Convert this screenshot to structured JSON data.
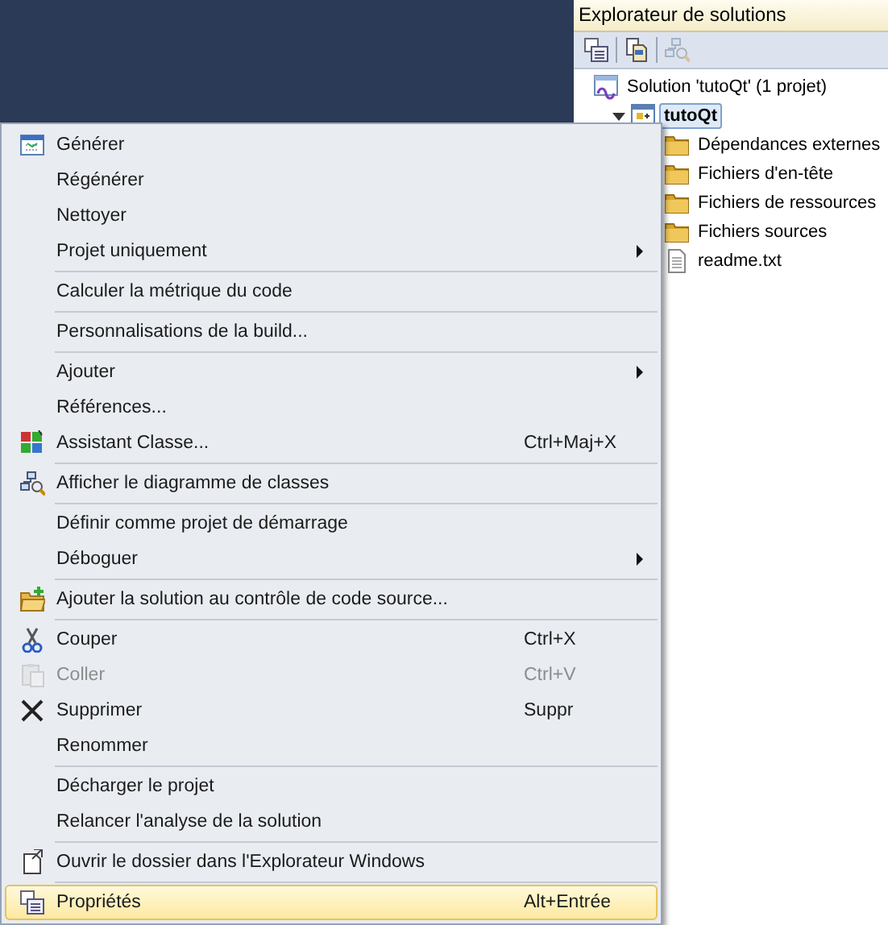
{
  "solution_explorer": {
    "title": "Explorateur de solutions",
    "toolbar": [
      {
        "disabled": false
      },
      {
        "disabled": false
      },
      {
        "disabled": true
      }
    ],
    "tree": [
      {
        "label": "Solution 'tutoQt' (1 projet)",
        "kind": "solution",
        "selected": false,
        "children": [
          {
            "label": "tutoQt",
            "kind": "project",
            "selected": true,
            "expanded": true,
            "children": [
              {
                "label": "Dépendances externes",
                "kind": "folder",
                "selected": false
              },
              {
                "label": "Fichiers d'en-tête",
                "kind": "folder",
                "selected": false
              },
              {
                "label": "Fichiers de ressources",
                "kind": "folder",
                "selected": false
              },
              {
                "label": "Fichiers sources",
                "kind": "folder",
                "selected": false
              },
              {
                "label": "readme.txt",
                "kind": "file",
                "selected": false
              }
            ]
          }
        ]
      }
    ]
  },
  "context_menu": [
    {
      "kind": "item",
      "label": "Générer",
      "selected": false,
      "disabled": false
    },
    {
      "kind": "item",
      "label": "Régénérer",
      "selected": false,
      "disabled": false
    },
    {
      "kind": "item",
      "label": "Nettoyer",
      "selected": false,
      "disabled": false
    },
    {
      "kind": "item",
      "label": "Projet uniquement",
      "submenu": true,
      "selected": false,
      "disabled": false
    },
    {
      "kind": "separator"
    },
    {
      "kind": "item",
      "label": "Calculer la métrique du code",
      "selected": false,
      "disabled": false
    },
    {
      "kind": "separator"
    },
    {
      "kind": "item",
      "label": "Personnalisations de la build...",
      "selected": false,
      "disabled": false
    },
    {
      "kind": "separator"
    },
    {
      "kind": "item",
      "label": "Ajouter",
      "submenu": true,
      "selected": false,
      "disabled": false
    },
    {
      "kind": "item",
      "label": "Références...",
      "selected": false,
      "disabled": false
    },
    {
      "kind": "item",
      "label": "Assistant Classe...",
      "shortcut": "Ctrl+Maj+X",
      "selected": false,
      "disabled": false
    },
    {
      "kind": "separator"
    },
    {
      "kind": "item",
      "label": "Afficher le diagramme de classes",
      "selected": false,
      "disabled": false
    },
    {
      "kind": "separator"
    },
    {
      "kind": "item",
      "label": "Définir comme projet de démarrage",
      "selected": false,
      "disabled": false
    },
    {
      "kind": "item",
      "label": "Déboguer",
      "submenu": true,
      "selected": false,
      "disabled": false
    },
    {
      "kind": "separator"
    },
    {
      "kind": "item",
      "label": "Ajouter la solution au contrôle de code source...",
      "selected": false,
      "disabled": false
    },
    {
      "kind": "separator"
    },
    {
      "kind": "item",
      "label": "Couper",
      "shortcut": "Ctrl+X",
      "selected": false,
      "disabled": false
    },
    {
      "kind": "item",
      "label": "Coller",
      "shortcut": "Ctrl+V",
      "selected": false,
      "disabled": true
    },
    {
      "kind": "item",
      "label": "Supprimer",
      "shortcut": "Suppr",
      "selected": false,
      "disabled": false
    },
    {
      "kind": "item",
      "label": "Renommer",
      "selected": false,
      "disabled": false
    },
    {
      "kind": "separator"
    },
    {
      "kind": "item",
      "label": "Décharger le projet",
      "selected": false,
      "disabled": false
    },
    {
      "kind": "item",
      "label": "Relancer l'analyse de la solution",
      "selected": false,
      "disabled": false
    },
    {
      "kind": "separator"
    },
    {
      "kind": "item",
      "label": "Ouvrir le dossier dans l'Explorateur Windows",
      "selected": false,
      "disabled": false
    },
    {
      "kind": "separator"
    },
    {
      "kind": "item",
      "label": "Propriétés",
      "shortcut": "Alt+Entrée",
      "selected": true,
      "disabled": false
    }
  ]
}
